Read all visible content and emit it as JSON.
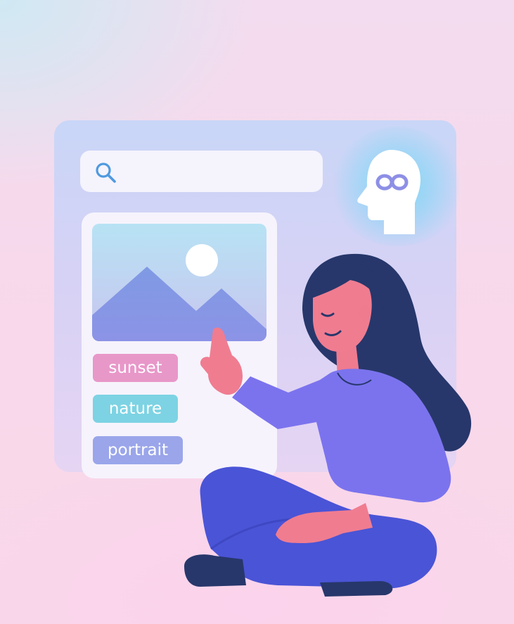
{
  "tags": [
    {
      "label": "sunset",
      "color": "#e897c9"
    },
    {
      "label": "nature",
      "color": "#7dd3e3"
    },
    {
      "label": "portrait",
      "color": "#9aa5ea"
    }
  ],
  "icons": {
    "search": "search-icon",
    "ai": "ai-head-icon",
    "image": "image-placeholder-icon"
  },
  "colors": {
    "accent_purple": "#7b73ee",
    "hair": "#27376b",
    "skin": "#f07c90",
    "pants": "#4a54d6",
    "glow": "#7ad6f5"
  }
}
